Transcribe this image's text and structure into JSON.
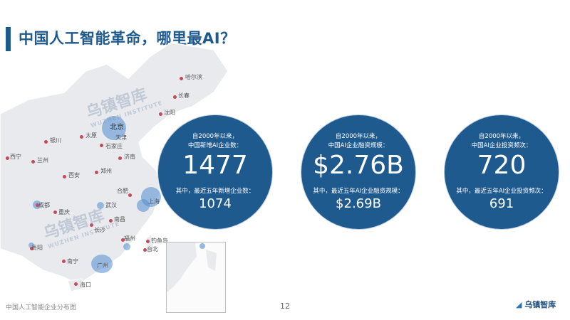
{
  "title": "中国人工智能革命，哪里最AI？",
  "stats": [
    {
      "line1": "自2000年以来，",
      "line2": "中国新增AI企业数：",
      "value": "1477",
      "sub": "其中，最近五年新增企业数：",
      "sub_value": "1074"
    },
    {
      "line1": "自2000年以来，",
      "line2": "中国AI企业融资规模：",
      "value": "$2.76B",
      "sub": "其中，最近五年AI企业融资规模：",
      "sub_value": "$2.69B"
    },
    {
      "line1": "自2000年以来，",
      "line2": "中国AI企业投资频次：",
      "value": "720",
      "sub": "其中，最近五年AI企业投资频次：",
      "sub_value": "691"
    }
  ],
  "map": {
    "cities": [
      "哈尔滨",
      "长春",
      "沈阳",
      "北京",
      "天津",
      "银川",
      "太原",
      "石家庄",
      "济南",
      "西宁",
      "兰州",
      "郑州",
      "西安",
      "合肥",
      "上海",
      "成都",
      "武汉",
      "重庆",
      "南昌",
      "长沙",
      "福州",
      "钓鱼岛",
      "台北",
      "贵阳",
      "南宁",
      "广州",
      "海口"
    ],
    "watermark": "乌镇智库",
    "watermark_sub": "WUZHEN INSTITUTE"
  },
  "footer": {
    "left": "中国人工智能企业分布图",
    "page": "12",
    "logo": "乌镇智库"
  }
}
